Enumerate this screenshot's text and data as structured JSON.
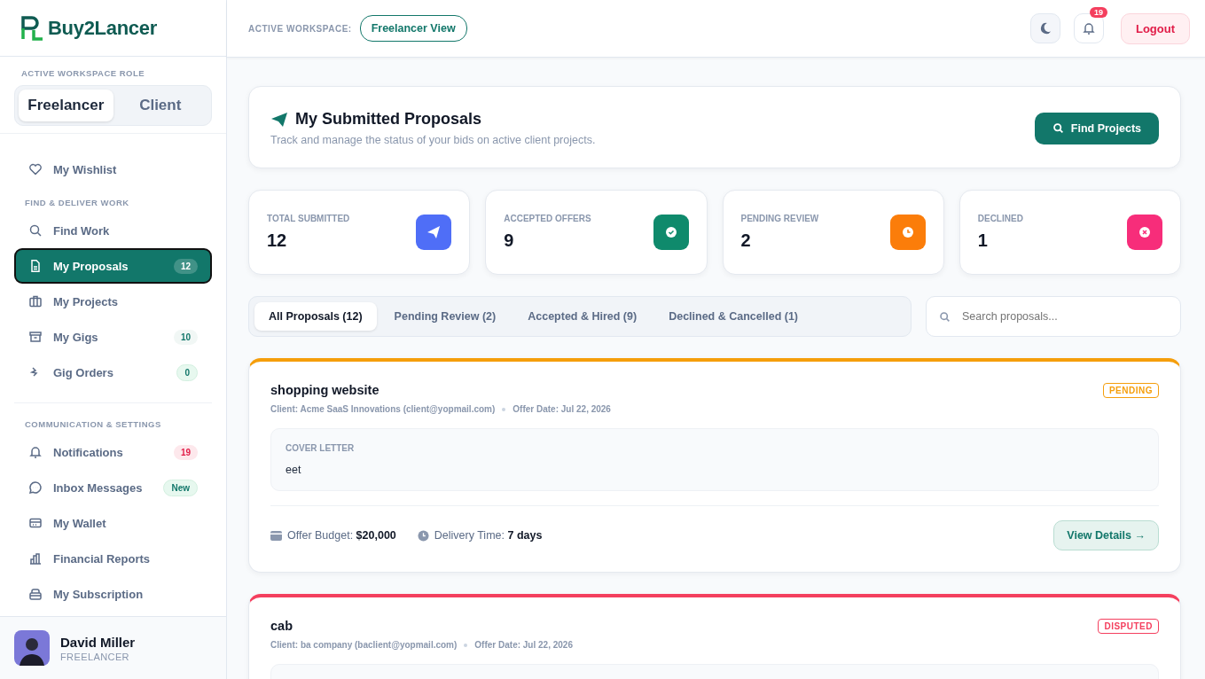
{
  "brand": {
    "logo_text": "Buy2Lancer"
  },
  "role_switch": {
    "label": "ACTIVE WORKSPACE ROLE",
    "options": [
      {
        "label": "Freelancer",
        "selected": true
      },
      {
        "label": "Client",
        "selected": false
      }
    ]
  },
  "sidebar": {
    "sections": [
      {
        "items": [
          {
            "label": "My Wishlist",
            "selected": false
          }
        ]
      },
      {
        "heading": "FIND & DELIVER WORK",
        "items": [
          {
            "label": "Find Work",
            "selected": false
          },
          {
            "label": "My Proposals",
            "selected": true,
            "badge": "12"
          },
          {
            "label": "My Projects",
            "selected": false
          },
          {
            "label": "My Gigs",
            "selected": false,
            "badge": "10"
          },
          {
            "label": "Gig Orders",
            "selected": false,
            "badge": "0"
          }
        ]
      },
      {
        "heading": "COMMUNICATION & SETTINGS",
        "items": [
          {
            "label": "Notifications",
            "selected": false,
            "badge": "19"
          },
          {
            "label": "Inbox Messages",
            "selected": false,
            "badge": "New"
          },
          {
            "label": "My Wallet",
            "selected": false
          },
          {
            "label": "Financial Reports",
            "selected": false
          },
          {
            "label": "My Subscription",
            "selected": false
          }
        ]
      }
    ]
  },
  "user": {
    "name": "David Miller",
    "role": "FREELANCER"
  },
  "topbar": {
    "workspace_label": "ACTIVE WORKSPACE:",
    "workspace_value": "Freelancer View",
    "notification_count": "19",
    "logout": "Logout"
  },
  "header": {
    "title": "My Submitted Proposals",
    "subtitle": "Track and manage the status of your bids on active client projects.",
    "action": "Find Projects"
  },
  "stats": [
    {
      "label": "TOTAL SUBMITTED",
      "value": "12",
      "kind": "send",
      "color": "#4f6ef7"
    },
    {
      "label": "ACCEPTED OFFERS",
      "value": "9",
      "kind": "check",
      "color": "#0f8a6c"
    },
    {
      "label": "PENDING REVIEW",
      "value": "2",
      "kind": "clock",
      "color": "#fb7d0a"
    },
    {
      "label": "DECLINED",
      "value": "1",
      "kind": "cross",
      "color": "#f72d7a"
    }
  ],
  "tabs": [
    {
      "label": "All Proposals (12)",
      "selected": true
    },
    {
      "label": "Pending Review (2)",
      "selected": false
    },
    {
      "label": "Accepted & Hired (9)",
      "selected": false
    },
    {
      "label": "Declined & Cancelled (1)",
      "selected": false
    }
  ],
  "search": {
    "placeholder": "Search proposals..."
  },
  "proposals": [
    {
      "title": "shopping website",
      "client": "Client: Acme SaaS Innovations (client@yopmail.com)",
      "date": "Offer Date: Jul 22, 2026",
      "status": "PENDING",
      "color": "#f59e0b",
      "cover_label": "COVER LETTER",
      "cover_text": "eet",
      "budget_label": "Offer Budget:",
      "budget": "$20,000",
      "delivery_label": "Delivery Time:",
      "delivery": "7 days",
      "action": "View Details →"
    },
    {
      "title": "cab",
      "client": "Client: ba company (baclient@yopmail.com)",
      "date": "Offer Date: Jul 22, 2026",
      "status": "DISPUTED",
      "color": "#f43f5e"
    }
  ]
}
